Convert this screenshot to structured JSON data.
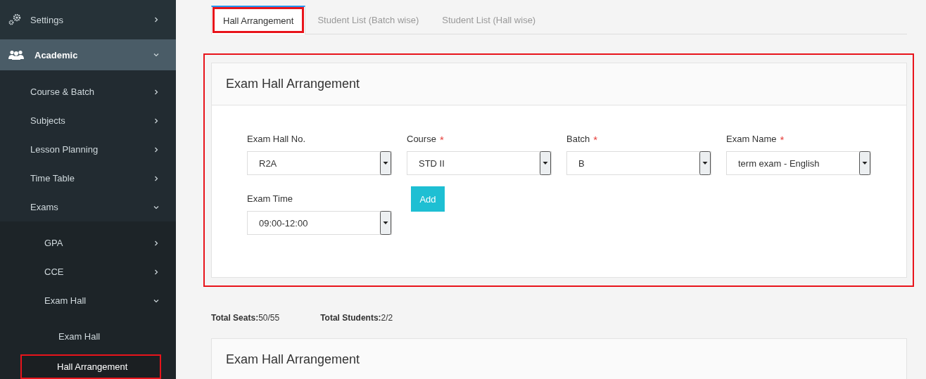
{
  "sidebar": {
    "items": [
      {
        "label": "Settings",
        "expanded": false,
        "selected": false,
        "highlighted": false
      },
      {
        "label": "Academic",
        "expanded": true,
        "selected": false,
        "highlighted": false,
        "children": [
          {
            "label": "Course & Batch",
            "expanded": false,
            "selected": false,
            "highlighted": false
          },
          {
            "label": "Subjects",
            "expanded": false,
            "selected": false,
            "highlighted": false
          },
          {
            "label": "Lesson Planning",
            "expanded": false,
            "selected": false,
            "highlighted": false
          },
          {
            "label": "Time Table",
            "expanded": false,
            "selected": false,
            "highlighted": false
          },
          {
            "label": "Exams",
            "expanded": true,
            "selected": false,
            "highlighted": false,
            "children": [
              {
                "label": "GPA",
                "expanded": false,
                "selected": false,
                "highlighted": false
              },
              {
                "label": "CCE",
                "expanded": false,
                "selected": false,
                "highlighted": false
              },
              {
                "label": "Exam Hall",
                "expanded": true,
                "selected": false,
                "highlighted": false,
                "children": [
                  {
                    "label": "Exam Hall",
                    "selected": false,
                    "highlighted": false
                  },
                  {
                    "label": "Hall Arrangement",
                    "selected": true,
                    "highlighted": true
                  }
                ]
              }
            ]
          }
        ]
      }
    ]
  },
  "tabs": [
    {
      "label": "Hall Arrangement",
      "selected": true,
      "highlighted": true
    },
    {
      "label": "Student List (Batch wise)",
      "selected": false,
      "highlighted": false
    },
    {
      "label": "Student List (Hall wise)",
      "selected": false,
      "highlighted": false
    }
  ],
  "form_card": {
    "title": "Exam Hall Arrangement",
    "highlighted": true,
    "fields": [
      {
        "label": "Exam Hall No.",
        "value": "R2A"
      },
      {
        "label": "Course",
        "required": true,
        "value": "STD II"
      },
      {
        "label": "Batch",
        "required": true,
        "value": "B"
      },
      {
        "label": "Exam Name",
        "required": true,
        "value": "term exam - English"
      },
      {
        "label": "Exam Time",
        "value": "09:00-12:00"
      }
    ],
    "required_mark": "*",
    "button": "Add"
  },
  "totals": [
    {
      "label": "Total Seats:",
      "value": "50/55"
    },
    {
      "label": "Total Students:",
      "value": "2/2"
    }
  ],
  "result_card": {
    "title": "Exam Hall Arrangement"
  }
}
